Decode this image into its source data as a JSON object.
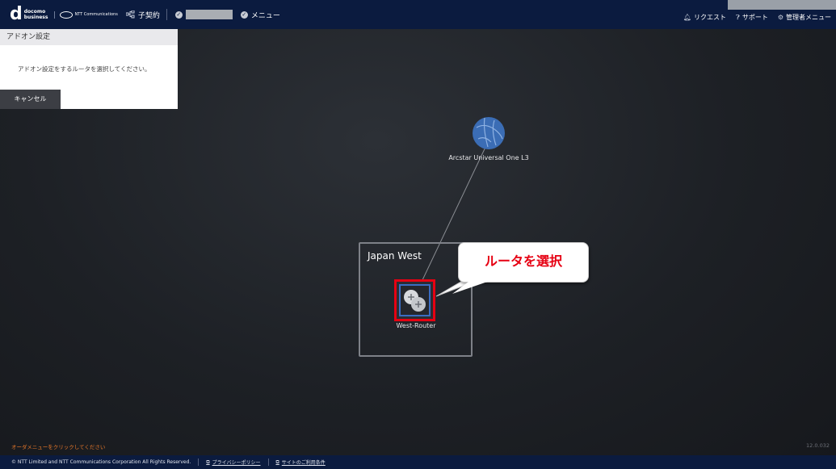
{
  "header": {
    "logo_docomo_top": "docomo",
    "logo_docomo_bottom": "business",
    "logo_ntt": "NTT Communications",
    "child_contract": "子契約",
    "menu": "メニュー",
    "request": "リクエスト",
    "support": "サポート",
    "admin_menu": "管理者メニュー"
  },
  "panel": {
    "title": "アドオン設定",
    "message": "アドオン設定をするルータを選択してください。",
    "cancel_label": "キャンセル"
  },
  "map": {
    "cloud_label": "Arcstar Universal One L3",
    "region_title": "Japan West",
    "router_label": "West-Router",
    "callout_text": "ルータを選択",
    "highlight_color": "#e60012",
    "selection_color": "#3a6cc2"
  },
  "status": {
    "message": "オーダメニューをクリックしてください",
    "version": "12.0.032"
  },
  "footer": {
    "copyright": "© NTT Limited and NTT Communications Corporation All Rights Reserved.",
    "privacy": "プライバシーポリシー",
    "terms": "サイトのご利用条件"
  },
  "colors": {
    "header_bg": "#0b1b3f",
    "status_text": "#e8782a"
  }
}
